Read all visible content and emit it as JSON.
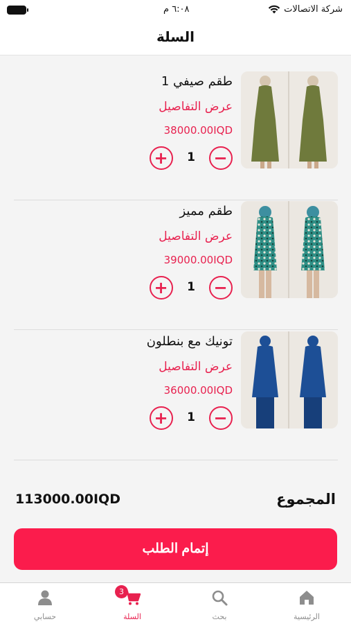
{
  "status_bar": {
    "carrier": "شركة الاتصالات",
    "time": "٦:٠٨ م"
  },
  "header": {
    "title": "السلة"
  },
  "cart": {
    "details_label": "عرض التفاصيل",
    "items": [
      {
        "name": "طقم صيفي 1",
        "price": "38000.00IQD",
        "quantity": "1",
        "image": "green-dress-photo",
        "color": "#6f7a3c"
      },
      {
        "name": "طقم مميز",
        "price": "39000.00IQD",
        "quantity": "1",
        "image": "teal-pattern-dress-photo",
        "color": "#2f8f86"
      },
      {
        "name": "تونيك مع بنطلون",
        "price": "36000.00IQD",
        "quantity": "1",
        "image": "blue-tunic-photo",
        "color": "#1d4f96"
      }
    ]
  },
  "summary": {
    "total_label": "المجموع",
    "total_value": "113000.00IQD"
  },
  "checkout": {
    "label": "إتمام الطلب"
  },
  "tabs": {
    "home": {
      "label": "الرئيسية",
      "icon": "home-icon"
    },
    "search": {
      "label": "بحث",
      "icon": "search-icon"
    },
    "cart": {
      "label": "السلة",
      "icon": "cart-icon",
      "badge": "3"
    },
    "account": {
      "label": "حسابي",
      "icon": "user-icon"
    }
  },
  "colors": {
    "accent": "#e8214f",
    "button": "#fb1c4c",
    "inactive": "#8d8d8d"
  }
}
